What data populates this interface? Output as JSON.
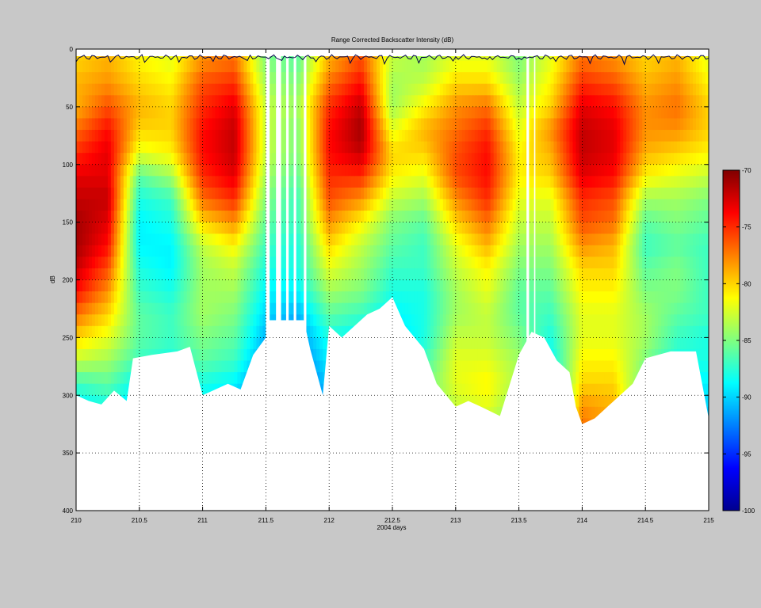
{
  "chart_data": {
    "type": "heatmap",
    "title": "Range Corrected Backscatter Intensity (dB)",
    "xlabel": "2004 days",
    "ylabel": "dB",
    "xlim": [
      210,
      215
    ],
    "ylim": [
      400,
      0
    ],
    "x_ticks": [
      "210",
      "210.5",
      "211",
      "211.5",
      "212",
      "212.5",
      "213",
      "213.5",
      "214",
      "214.5",
      "215"
    ],
    "y_ticks": [
      "0",
      "50",
      "100",
      "150",
      "200",
      "250",
      "300",
      "350",
      "400"
    ],
    "grid": "dotted",
    "colorbar": {
      "range": [
        -100,
        -70
      ],
      "ticks": [
        "-70",
        "-75",
        "-80",
        "-85",
        "-90",
        "-95",
        "-100"
      ],
      "colormap": "jet"
    },
    "x": [
      210.0,
      210.25,
      210.5,
      210.75,
      211.0,
      211.25,
      211.5,
      211.75,
      212.0,
      212.25,
      212.5,
      212.75,
      213.0,
      213.25,
      213.5,
      213.75,
      214.0,
      214.25,
      214.5,
      214.75,
      215.0
    ],
    "y": [
      10,
      30,
      50,
      70,
      90,
      110,
      130,
      150,
      170,
      190,
      210,
      230,
      250,
      270,
      290,
      310,
      330
    ],
    "z": [
      [
        -80,
        -79,
        -79,
        -77,
        -75,
        -73,
        -72,
        -71,
        -71,
        -72,
        -74,
        -77,
        -80,
        -83,
        -87,
        -89,
        -90
      ],
      [
        -79,
        -78,
        -76,
        -74,
        -73,
        -73,
        -72,
        -73,
        -74,
        -76,
        -78,
        -80,
        -82,
        -84,
        -86,
        -88,
        -90
      ],
      [
        -81,
        -80,
        -79,
        -80,
        -82,
        -86,
        -88,
        -89,
        -89,
        -88,
        -87,
        -86,
        -86,
        -87,
        -89,
        -90,
        -91
      ],
      [
        -82,
        -81,
        -80,
        -80,
        -81,
        -84,
        -87,
        -88,
        -89,
        -89,
        -88,
        -87,
        -87,
        -88,
        -89,
        -90,
        -91
      ],
      [
        -78,
        -76,
        -75,
        -74,
        -74,
        -75,
        -77,
        -80,
        -83,
        -84,
        -84,
        -84,
        -85,
        -86,
        -88,
        -89,
        -90
      ],
      [
        -77,
        -75,
        -73,
        -72,
        -72,
        -73,
        -75,
        -78,
        -81,
        -83,
        -84,
        -85,
        -86,
        -87,
        -89,
        -90,
        -91
      ],
      [
        -85,
        -84,
        -83,
        -83,
        -83,
        -84,
        -85,
        -86,
        -87,
        -88,
        -89,
        -90,
        -91,
        -92,
        -93,
        -94,
        -95
      ],
      [
        -86,
        -85,
        -84,
        -85,
        -85,
        -86,
        -87,
        -87,
        -88,
        -88,
        -89,
        -91,
        -92,
        -93,
        -94,
        -95,
        -96
      ],
      [
        -79,
        -77,
        -75,
        -74,
        -74,
        -75,
        -76,
        -78,
        -80,
        -82,
        -84,
        -86,
        -88,
        -89,
        -90,
        -91,
        -92
      ],
      [
        -76,
        -74,
        -72,
        -71,
        -72,
        -75,
        -78,
        -81,
        -83,
        -84,
        -85,
        -87,
        -89,
        -90,
        -91,
        -92,
        -93
      ],
      [
        -83,
        -84,
        -84,
        -82,
        -80,
        -81,
        -83,
        -85,
        -86,
        -87,
        -88,
        -89,
        -90,
        -91,
        -92,
        -93,
        -94
      ],
      [
        -84,
        -83,
        -81,
        -79,
        -80,
        -82,
        -84,
        -86,
        -87,
        -87,
        -88,
        -88,
        -88,
        -87,
        -86,
        -86,
        -87
      ],
      [
        -82,
        -80,
        -78,
        -77,
        -76,
        -76,
        -78,
        -80,
        -82,
        -83,
        -84,
        -84,
        -83,
        -82,
        -82,
        -83,
        -84
      ],
      [
        -82,
        -80,
        -77,
        -75,
        -74,
        -74,
        -75,
        -77,
        -79,
        -81,
        -82,
        -83,
        -83,
        -82,
        -81,
        -82,
        -83
      ],
      [
        -85,
        -84,
        -83,
        -82,
        -81,
        -81,
        -82,
        -83,
        -84,
        -85,
        -86,
        -86,
        -85,
        -84,
        -84,
        -85,
        -86
      ],
      [
        -82,
        -81,
        -80,
        -78,
        -79,
        -80,
        -82,
        -83,
        -84,
        -85,
        -86,
        -87,
        -88,
        -89,
        -90,
        -91,
        -92
      ],
      [
        -77,
        -75,
        -73,
        -72,
        -72,
        -73,
        -75,
        -76,
        -78,
        -80,
        -81,
        -82,
        -82,
        -81,
        -80,
        -78,
        -77
      ],
      [
        -78,
        -76,
        -74,
        -73,
        -73,
        -74,
        -76,
        -77,
        -79,
        -80,
        -81,
        -82,
        -82,
        -81,
        -80,
        -79,
        -79
      ],
      [
        -80,
        -79,
        -78,
        -78,
        -79,
        -81,
        -84,
        -86,
        -87,
        -86,
        -85,
        -84,
        -84,
        -85,
        -86,
        -87,
        -88
      ],
      [
        -79,
        -78,
        -77,
        -78,
        -80,
        -82,
        -84,
        -85,
        -86,
        -85,
        -85,
        -86,
        -87,
        -88,
        -89,
        -90,
        -91
      ],
      [
        -82,
        -81,
        -80,
        -80,
        -81,
        -83,
        -85,
        -86,
        -87,
        -87,
        -87,
        -87,
        -88,
        -88,
        -89,
        -90,
        -91
      ]
    ],
    "bottom_depth": [
      [
        210.0,
        300
      ],
      [
        210.1,
        305
      ],
      [
        210.2,
        308
      ],
      [
        210.3,
        296
      ],
      [
        210.4,
        305
      ],
      [
        210.45,
        268
      ],
      [
        210.6,
        265
      ],
      [
        210.8,
        262
      ],
      [
        210.9,
        258
      ],
      [
        211.0,
        300
      ],
      [
        211.1,
        295
      ],
      [
        211.2,
        290
      ],
      [
        211.3,
        295
      ],
      [
        211.4,
        265
      ],
      [
        211.5,
        250
      ],
      [
        211.53,
        235
      ],
      [
        211.8,
        235
      ],
      [
        211.85,
        260
      ],
      [
        211.95,
        300
      ],
      [
        212.0,
        240
      ],
      [
        212.1,
        250
      ],
      [
        212.3,
        230
      ],
      [
        212.4,
        225
      ],
      [
        212.5,
        215
      ],
      [
        212.6,
        240
      ],
      [
        212.75,
        260
      ],
      [
        212.85,
        290
      ],
      [
        213.0,
        310
      ],
      [
        213.1,
        305
      ],
      [
        213.2,
        310
      ],
      [
        213.35,
        318
      ],
      [
        213.5,
        265
      ],
      [
        213.6,
        245
      ],
      [
        213.7,
        250
      ],
      [
        213.8,
        270
      ],
      [
        213.9,
        280
      ],
      [
        213.95,
        310
      ],
      [
        214.0,
        325
      ],
      [
        214.1,
        320
      ],
      [
        214.2,
        310
      ],
      [
        214.3,
        300
      ],
      [
        214.4,
        290
      ],
      [
        214.5,
        268
      ],
      [
        214.7,
        262
      ],
      [
        214.9,
        262
      ],
      [
        215.0,
        320
      ]
    ],
    "gaps": [
      [
        211.5,
        211.53
      ],
      [
        211.58,
        211.62
      ],
      [
        211.66,
        211.68
      ],
      [
        211.72,
        211.74
      ],
      [
        211.8,
        211.82
      ],
      [
        213.56,
        213.58
      ],
      [
        213.62,
        213.63
      ]
    ]
  }
}
